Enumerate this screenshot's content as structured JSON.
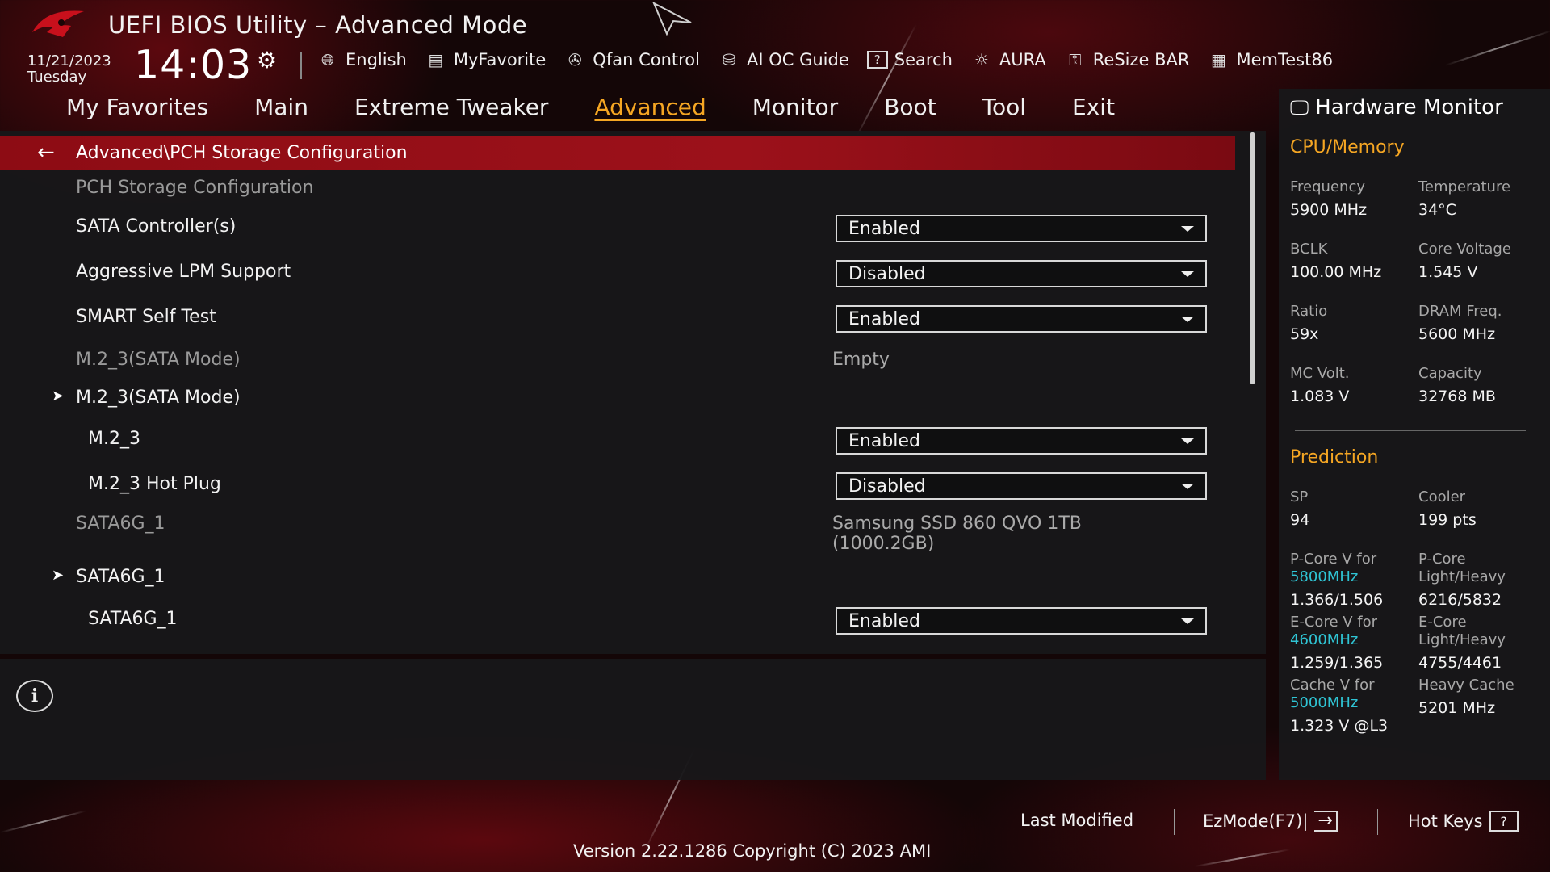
{
  "header": {
    "title": "UEFI BIOS Utility – Advanced Mode",
    "date": "11/21/2023",
    "day": "Tuesday",
    "time": "14:03"
  },
  "toolbar": [
    {
      "label": "English",
      "icon": "globe-icon"
    },
    {
      "label": "MyFavorite",
      "icon": "favorite-icon"
    },
    {
      "label": "Qfan Control",
      "icon": "fan-icon"
    },
    {
      "label": "AI OC Guide",
      "icon": "ai-guide-icon"
    },
    {
      "label": "Search",
      "icon": "search-icon"
    },
    {
      "label": "AURA",
      "icon": "aura-icon"
    },
    {
      "label": "ReSize BAR",
      "icon": "resize-bar-icon"
    },
    {
      "label": "MemTest86",
      "icon": "memtest-icon"
    }
  ],
  "tabs": [
    "My Favorites",
    "Main",
    "Extreme Tweaker",
    "Advanced",
    "Monitor",
    "Boot",
    "Tool",
    "Exit"
  ],
  "active_tab": "Advanced",
  "breadcrumb": "Advanced\\PCH Storage Configuration",
  "rows": [
    {
      "label": "PCH Storage Configuration",
      "type": "header"
    },
    {
      "label": "SATA Controller(s)",
      "type": "dropdown",
      "value": "Enabled"
    },
    {
      "label": "Aggressive LPM Support",
      "type": "dropdown",
      "value": "Disabled"
    },
    {
      "label": "SMART Self Test",
      "type": "dropdown",
      "value": "Enabled"
    },
    {
      "label": "M.2_3(SATA Mode)",
      "type": "info",
      "value": "Empty"
    },
    {
      "label": "M.2_3(SATA Mode)",
      "type": "submenu"
    },
    {
      "label": "M.2_3",
      "type": "dropdown",
      "value": "Enabled"
    },
    {
      "label": "M.2_3 Hot Plug",
      "type": "dropdown",
      "value": "Disabled"
    },
    {
      "label": "SATA6G_1",
      "type": "info",
      "value": "Samsung SSD 860 QVO 1TB",
      "value2": "(1000.2GB)"
    },
    {
      "label": "SATA6G_1",
      "type": "submenu"
    },
    {
      "label": "SATA6G_1",
      "type": "dropdown",
      "value": "Enabled"
    }
  ],
  "hardware_monitor": {
    "title": "Hardware Monitor",
    "cpu_memory_label": "CPU/Memory",
    "cpu_memory": [
      {
        "k": "Frequency",
        "v": "5900 MHz"
      },
      {
        "k": "Temperature",
        "v": "34°C"
      },
      {
        "k": "BCLK",
        "v": "100.00 MHz"
      },
      {
        "k": "Core Voltage",
        "v": "1.545 V"
      },
      {
        "k": "Ratio",
        "v": "59x"
      },
      {
        "k": "DRAM Freq.",
        "v": "5600 MHz"
      },
      {
        "k": "MC Volt.",
        "v": "1.083 V"
      },
      {
        "k": "Capacity",
        "v": "32768 MB"
      }
    ],
    "prediction_label": "Prediction",
    "prediction": [
      {
        "k": "SP",
        "v": "94"
      },
      {
        "k": "Cooler",
        "v": "199 pts"
      },
      {
        "k": "P-Core V for",
        "hl": "5800MHz",
        "v": "1.366/1.506"
      },
      {
        "k": "P-Core",
        "k2": "Light/Heavy",
        "v": "6216/5832"
      },
      {
        "k": "E-Core V for",
        "hl": "4600MHz",
        "v": "1.259/1.365"
      },
      {
        "k": "E-Core",
        "k2": "Light/Heavy",
        "v": "4755/4461"
      },
      {
        "k": "Cache V for",
        "hl": "5000MHz",
        "v": "1.323 V @L3"
      },
      {
        "k": "Heavy Cache",
        "v": "5201 MHz"
      }
    ]
  },
  "footer": {
    "last_modified": "Last Modified",
    "ezmode": "EzMode(F7)|",
    "hotkeys": "Hot Keys",
    "version": "Version 2.22.1286 Copyright (C) 2023 AMI"
  },
  "colors": {
    "accent": "#f5a623",
    "breadcrumb_bg": "#9c111a",
    "highlight": "#2fc4d4"
  }
}
